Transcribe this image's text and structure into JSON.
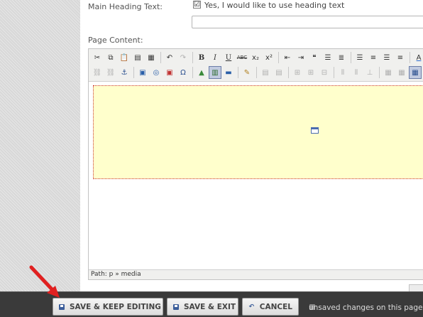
{
  "form": {
    "main_heading_label": "Main Heading Text:",
    "use_heading_checked": "☑",
    "use_heading_text": "Yes, I would like to use heading text",
    "heading_input_value": "",
    "page_content_label": "Page Content:"
  },
  "editor": {
    "path_label": "Path: p » media"
  },
  "bottom_bar": {
    "save_keep_label": "SAVE & KEEP EDITING",
    "save_exit_label": "SAVE & EXIT",
    "cancel_label": "CANCEL",
    "status_text": "unsaved changes on this page"
  },
  "colors": {
    "media_placeholder_bg": "#ffffcc",
    "annotation_arrow": "#e02020",
    "bottom_bar_bg": "#3a3a3a"
  }
}
